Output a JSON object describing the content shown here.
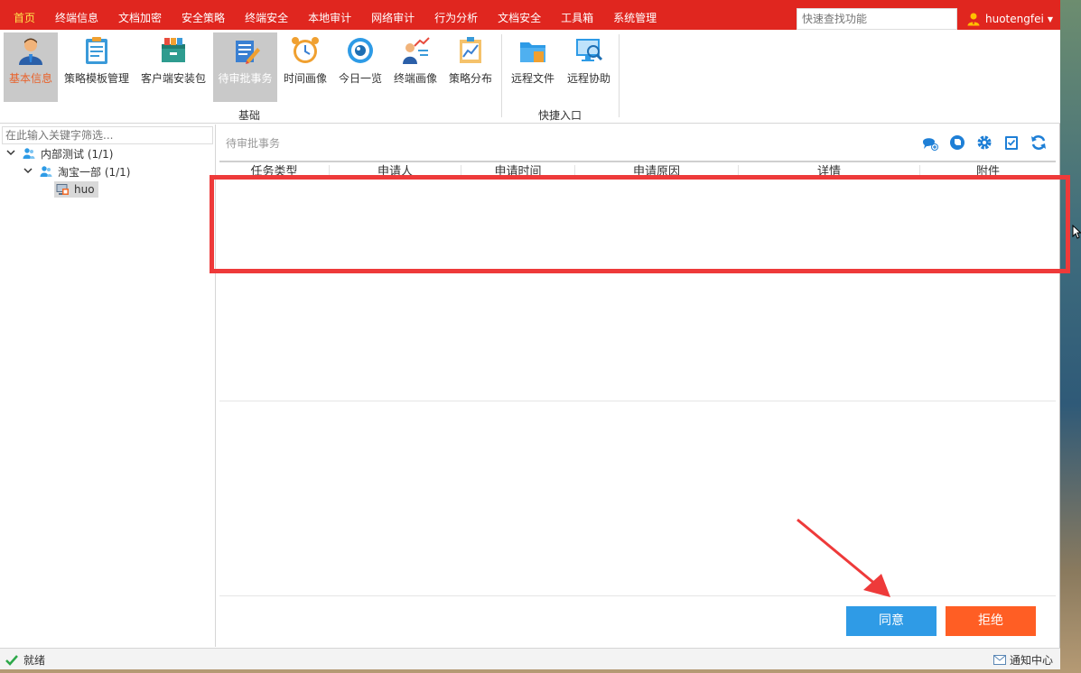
{
  "menu": {
    "items": [
      "首页",
      "终端信息",
      "文档加密",
      "安全策略",
      "终端安全",
      "本地审计",
      "网络审计",
      "行为分析",
      "文档安全",
      "工具箱",
      "系统管理"
    ],
    "active_index": 0
  },
  "search": {
    "placeholder": "快速查找功能"
  },
  "user": {
    "name": "huotengfei"
  },
  "ribbon": {
    "buttons": [
      {
        "label": "基本信息",
        "icon": "person-icon"
      },
      {
        "label": "策略模板管理",
        "icon": "clipboard-icon"
      },
      {
        "label": "客户端安装包",
        "icon": "package-icon"
      },
      {
        "label": "待审批事务",
        "icon": "approval-icon"
      },
      {
        "label": "时间画像",
        "icon": "alarm-clock-icon"
      },
      {
        "label": "今日一览",
        "icon": "eye-icon"
      },
      {
        "label": "终端画像",
        "icon": "user-chart-icon"
      },
      {
        "label": "策略分布",
        "icon": "chart-board-icon"
      },
      {
        "label": "远程文件",
        "icon": "folder-icon"
      },
      {
        "label": "远程协助",
        "icon": "monitor-search-icon"
      }
    ],
    "groups": [
      "基础",
      "快捷入口"
    ]
  },
  "tree": {
    "filter_placeholder": "在此输入关键字筛选...",
    "root": {
      "label": "内部测试 (1/1)"
    },
    "child": {
      "label": "淘宝一部 (1/1)"
    },
    "leaf": {
      "label": "huo"
    }
  },
  "panel": {
    "title": "待审批事务",
    "toolbar_icons": [
      "chat-add-icon",
      "tag-icon",
      "gear-icon",
      "checklist-icon",
      "refresh-icon"
    ],
    "columns": [
      "任务类型",
      "申请人",
      "申请时间",
      "申请原因",
      "详情",
      "附件"
    ]
  },
  "actions": {
    "agree": "同意",
    "reject": "拒绝"
  },
  "status": {
    "left": "就绪",
    "right": "通知中心"
  },
  "colors": {
    "menubar": "#e0261f",
    "agree": "#2f9be6",
    "reject": "#ff5e24",
    "annotation": "#ee3a3a"
  }
}
